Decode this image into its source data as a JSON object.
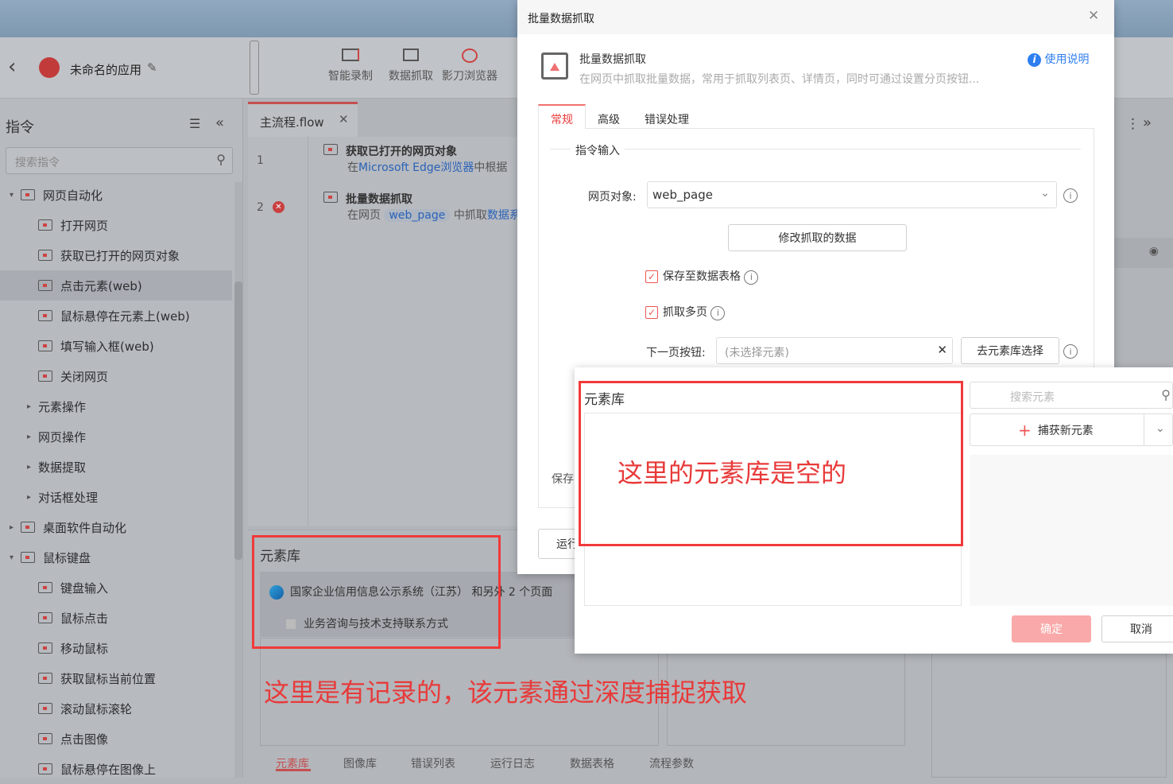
{
  "app": {
    "back": "‹",
    "name": "未命名的应用",
    "edit_icon": "✎"
  },
  "toolbar": [
    {
      "label": "智能录制"
    },
    {
      "label": "数据抓取"
    },
    {
      "label": "影刀浏览器"
    }
  ],
  "sidebar": {
    "title": "指令",
    "search_placeholder": "搜索指令",
    "items": [
      {
        "label": "网页自动化",
        "kind": "group"
      },
      {
        "label": "打开网页"
      },
      {
        "label": "获取已打开的网页对象"
      },
      {
        "label": "点击元素(web)",
        "selected": true
      },
      {
        "label": "鼠标悬停在元素上(web)"
      },
      {
        "label": "填写输入框(web)"
      },
      {
        "label": "关闭网页"
      },
      {
        "label": "元素操作",
        "kind": "sub"
      },
      {
        "label": "网页操作",
        "kind": "sub"
      },
      {
        "label": "数据提取",
        "kind": "sub"
      },
      {
        "label": "对话框处理",
        "kind": "sub"
      },
      {
        "label": "桌面软件自动化",
        "kind": "group"
      },
      {
        "label": "鼠标键盘",
        "kind": "group"
      },
      {
        "label": "键盘输入"
      },
      {
        "label": "鼠标点击"
      },
      {
        "label": "移动鼠标"
      },
      {
        "label": "获取鼠标当前位置"
      },
      {
        "label": "滚动鼠标滚轮"
      },
      {
        "label": "点击图像"
      },
      {
        "label": "鼠标悬停在图像上"
      }
    ]
  },
  "flow": {
    "tab": "主流程.flow",
    "steps": [
      {
        "num": "1",
        "title": "获取已打开的网页对象",
        "desc_prefix": "在",
        "desc_link": "Microsoft Edge浏览器",
        "desc_suffix": "中根据"
      },
      {
        "num": "2",
        "title": "批量数据抓取",
        "desc_prefix": "在网页",
        "desc_chip": "web_page",
        "desc_suffix": "中抓取",
        "desc_link": "数据系"
      }
    ]
  },
  "element_panel": {
    "title": "元素库",
    "page": "国家企业信用信息公示系统（江苏） 和另外 2 个页面",
    "element": "业务咨询与技术支持联系方式",
    "tabs": [
      "元素库",
      "图像库",
      "错误列表",
      "运行日志",
      "数据表格",
      "流程参数"
    ]
  },
  "annotations": {
    "bottom": "这里是有记录的，该元素通过深度捕捉获取",
    "dialog": "这里的元素库是空的"
  },
  "dialog": {
    "title": "批量数据抓取",
    "heading": "批量数据抓取",
    "desc": "在网页中抓取批量数据，常用于抓取列表页、详情页，同时可通过设置分页按钮...",
    "help": "使用说明",
    "tabs": [
      "常规",
      "高级",
      "错误处理"
    ],
    "section": "指令输入",
    "web_obj_label": "网页对象:",
    "web_obj_value": "web_page",
    "modify_btn": "修改抓取的数据",
    "save_table": "保存至数据表格",
    "multi_page": "抓取多页",
    "next_label": "下一页按钮:",
    "next_placeholder": "(未选择元素)",
    "lib_btn": "去元素库选择",
    "save_cut": "保存",
    "run_cut": "运行"
  },
  "picker": {
    "title": "元素库",
    "search_placeholder": "搜索元素",
    "capture": "捕获新元素",
    "ok": "确定",
    "cancel": "取消"
  }
}
